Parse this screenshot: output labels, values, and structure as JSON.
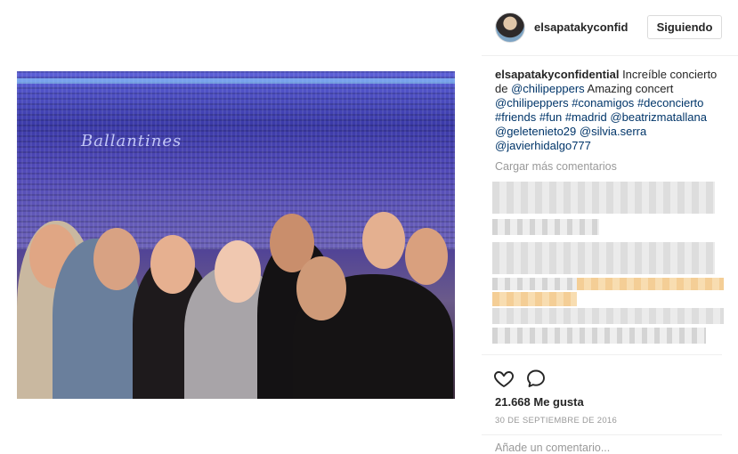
{
  "post": {
    "username": "elsapatakyconfid",
    "follow_label": "Siguiendo",
    "caption": {
      "user": "elsapatakyconfidential",
      "parts": [
        {
          "text": " Increíble concierto de ",
          "type": "text"
        },
        {
          "text": "@chilipeppers",
          "type": "tag"
        },
        {
          "text": " Amazing concert ",
          "type": "text"
        },
        {
          "text": "@chilipeppers",
          "type": "tag"
        },
        {
          "text": " ",
          "type": "text"
        },
        {
          "text": "#conamigos",
          "type": "tag"
        },
        {
          "text": " ",
          "type": "text"
        },
        {
          "text": "#deconcierto",
          "type": "tag"
        },
        {
          "text": " ",
          "type": "text"
        },
        {
          "text": "#friends",
          "type": "tag"
        },
        {
          "text": " ",
          "type": "text"
        },
        {
          "text": "#fun",
          "type": "tag"
        },
        {
          "text": " ",
          "type": "text"
        },
        {
          "text": "#madrid",
          "type": "tag"
        },
        {
          "text": " ",
          "type": "text"
        },
        {
          "text": "@beatrizmatallana",
          "type": "tag"
        },
        {
          "text": " ",
          "type": "text"
        },
        {
          "text": "@geletenieto29",
          "type": "tag"
        },
        {
          "text": " ",
          "type": "text"
        },
        {
          "text": "@silvia.serra",
          "type": "tag"
        },
        {
          "text": " ",
          "type": "text"
        },
        {
          "text": "@javierhidalgo777",
          "type": "tag"
        }
      ]
    },
    "load_more_label": "Cargar más comentarios",
    "likes": "21.668 Me gusta",
    "date": "30 DE SEPTIEMBRE DE 2016",
    "add_comment_placeholder": "Añade un comentario..."
  },
  "photo": {
    "banner_text": "Ballantines"
  },
  "icons": {
    "like": "heart-icon",
    "comment": "comment-bubble-icon"
  },
  "colors": {
    "link": "#003569",
    "muted": "#999999",
    "text": "#262626",
    "border": "#dbdbdb"
  }
}
